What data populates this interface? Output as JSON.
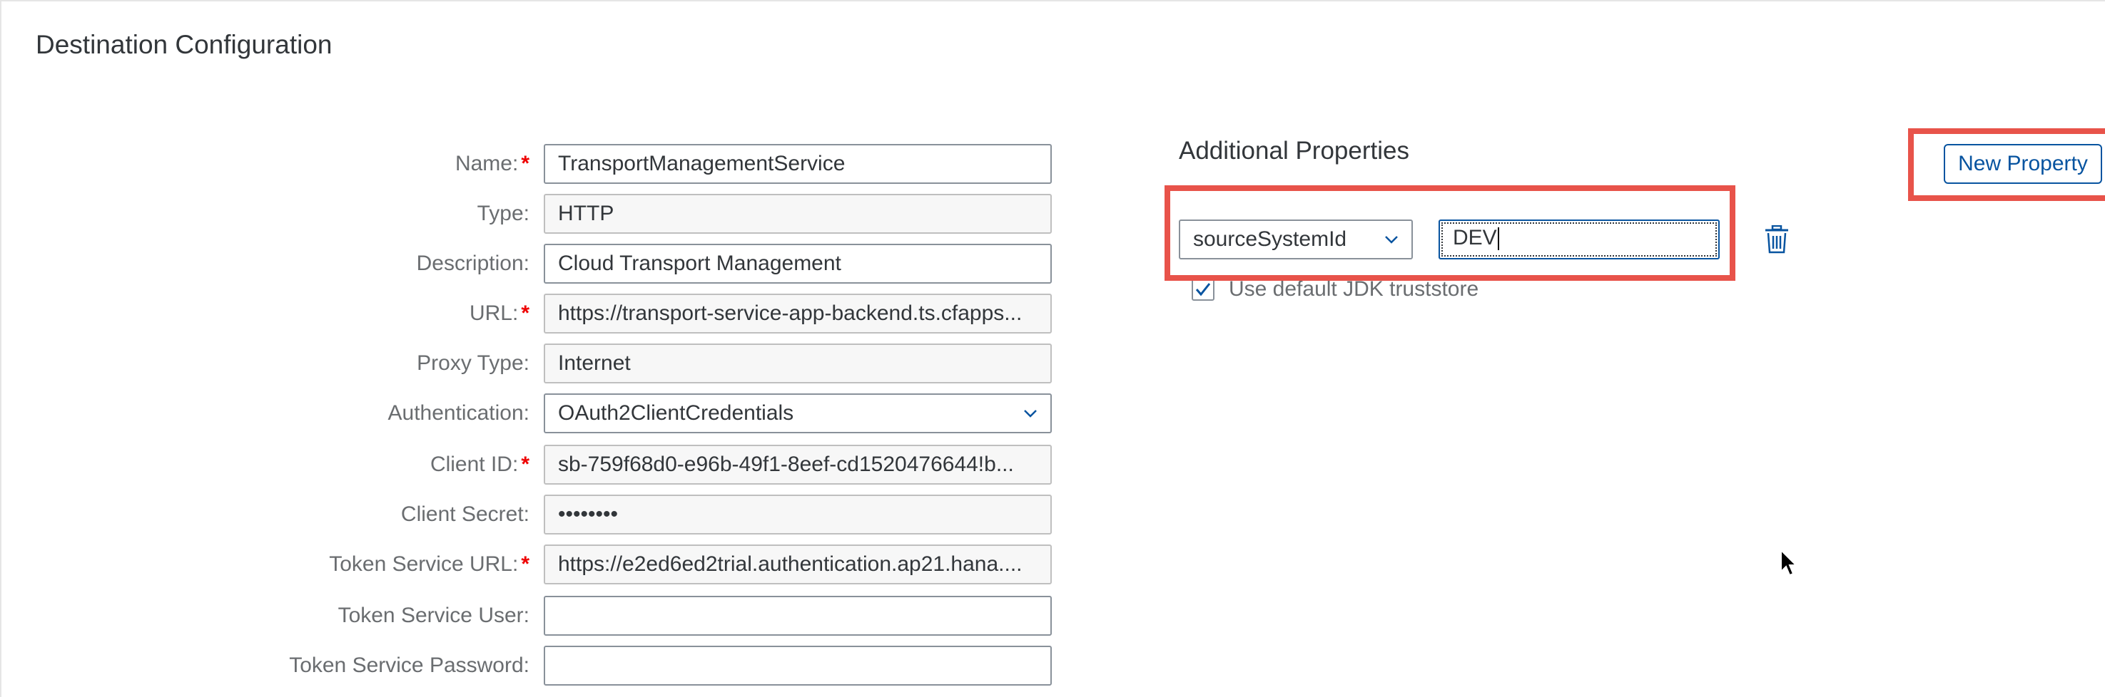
{
  "page": {
    "title": "Destination Configuration"
  },
  "form": {
    "fields": [
      {
        "label": "Name:",
        "required": true,
        "value": "TransportManagementService",
        "readonly": false,
        "type": "input"
      },
      {
        "label": "Type:",
        "required": false,
        "value": "HTTP",
        "readonly": true,
        "type": "input"
      },
      {
        "label": "Description:",
        "required": false,
        "value": "Cloud Transport Management",
        "readonly": false,
        "type": "input"
      },
      {
        "label": "URL:",
        "required": true,
        "value": "https://transport-service-app-backend.ts.cfapps...",
        "readonly": true,
        "type": "input"
      },
      {
        "label": "Proxy Type:",
        "required": false,
        "value": "Internet",
        "readonly": true,
        "type": "input"
      },
      {
        "label": "Authentication:",
        "required": false,
        "value": "OAuth2ClientCredentials",
        "readonly": false,
        "type": "select"
      },
      {
        "label": "Client ID:",
        "required": true,
        "value": "sb-759f68d0-e96b-49f1-8eef-cd1520476644!b...",
        "readonly": true,
        "type": "input"
      },
      {
        "label": "Client Secret:",
        "required": false,
        "value": "••••••••",
        "readonly": true,
        "type": "input"
      },
      {
        "label": "Token Service URL:",
        "required": true,
        "value": "https://e2ed6ed2trial.authentication.ap21.hana....",
        "readonly": true,
        "type": "input"
      },
      {
        "label": "Token Service User:",
        "required": false,
        "value": "",
        "readonly": false,
        "type": "input"
      },
      {
        "label": "Token Service Password:",
        "required": false,
        "value": "",
        "readonly": false,
        "type": "input"
      }
    ]
  },
  "additional": {
    "title": "Additional Properties",
    "new_property_label": "New Property",
    "property_key": "sourceSystemId",
    "property_value": "DEV",
    "checkbox_label": "Use default JDK truststore",
    "checkbox_checked": true
  },
  "colors": {
    "accent": "#0854a0",
    "highlight": "#e8534a",
    "required": "#e00000"
  },
  "icons": {
    "delete": "trash-icon",
    "dropdown": "chevron-down-icon",
    "check": "checkmark-icon",
    "cursor": "mouse-pointer-icon"
  }
}
